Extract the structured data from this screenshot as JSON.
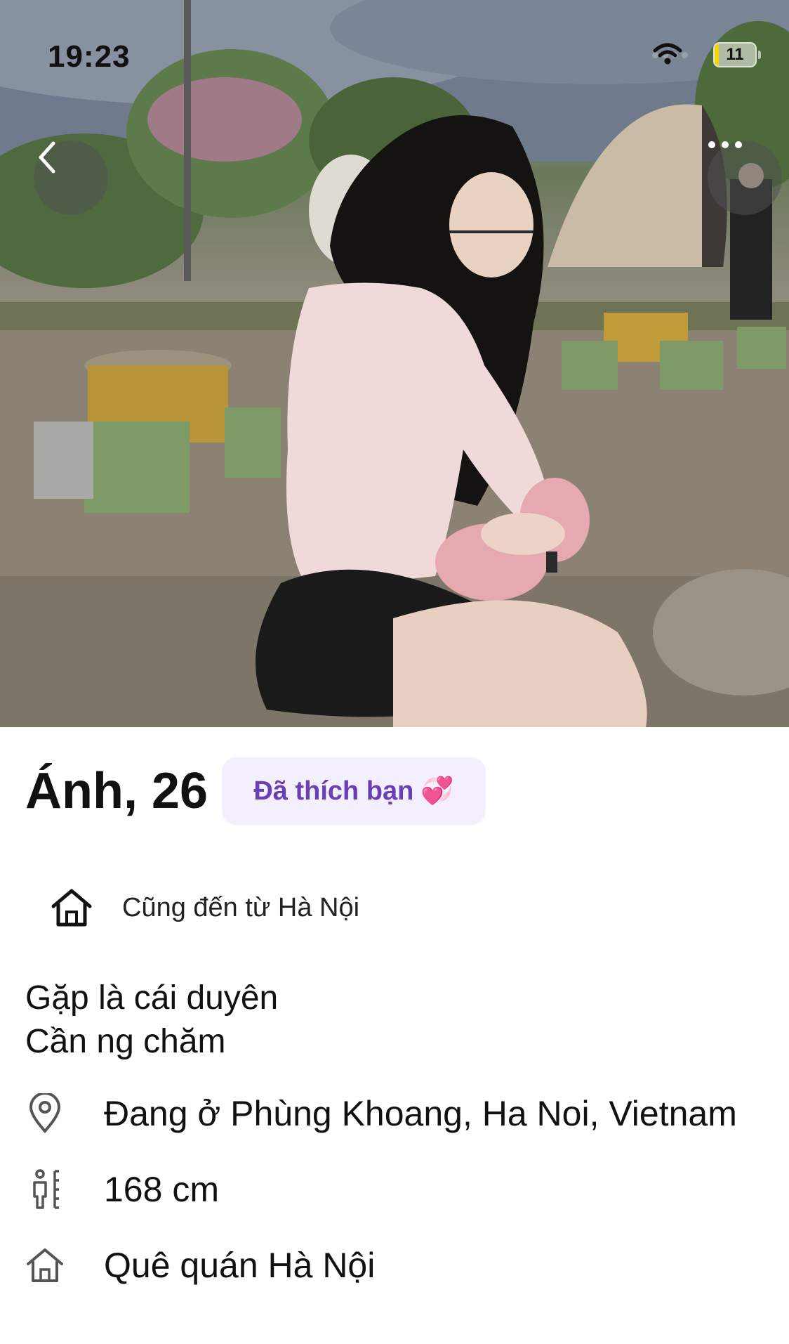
{
  "status_bar": {
    "time": "19:23",
    "battery_level": "11",
    "battery_fraction": 0.11,
    "wifi_icon": "wifi-icon",
    "signal_icon": "signal-dots-icon"
  },
  "nav": {
    "back_icon": "chevron-left-icon",
    "more_icon": "more-horizontal-icon"
  },
  "profile": {
    "name_age": "Ánh, 26",
    "like_badge": {
      "label": "Đã thích bạn",
      "emoji": "💞"
    },
    "shared_hometown": "Cũng đến từ Hà Nội",
    "bio_lines": [
      "Gặp là cái duyên",
      "Cần ng chăm"
    ],
    "details": {
      "location": "Đang ở Phùng Khoang, Ha Noi, Vietnam",
      "height": "168 cm",
      "hometown": "Quê quán Hà Nội"
    }
  },
  "colors": {
    "badge_bg": "#f3effc",
    "badge_text": "#6a3fb5",
    "text": "#111111"
  }
}
